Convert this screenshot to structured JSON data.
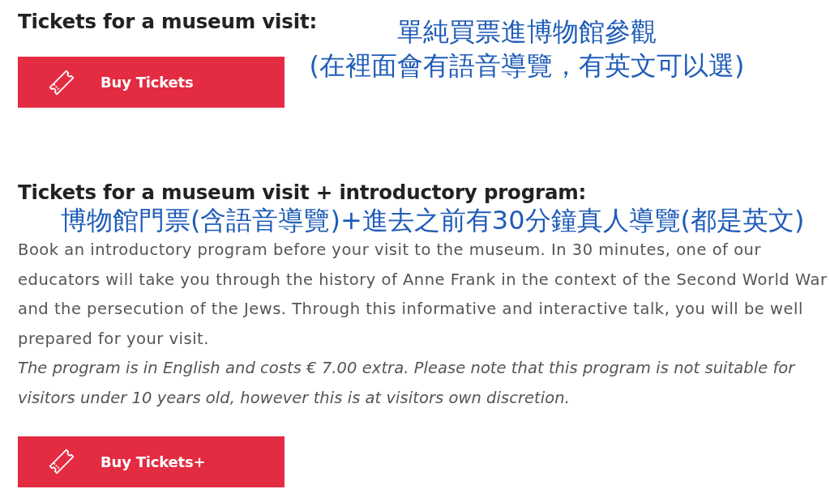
{
  "sections": [
    {
      "kind": "side-note",
      "heading": "Tickets for a museum visit:",
      "annotation": [
        "單純買票進博物館參觀",
        "(在裡面會有語音導覽，有英文可以選)"
      ],
      "button": "Buy Tickets"
    },
    {
      "kind": "inline-note",
      "heading": "Tickets for a museum visit + introductory program:",
      "annotation": [
        "博物館門票(含語音導覽)+進去之前有30分鐘真人導覽(都是英文)"
      ],
      "description": "Book an introductory program before your visit to the museum. In 30 minutes, one of our educators will take you through the history of Anne Frank in the context of the Second World War and the persecution of the Jews. Through this informative and interactive talk, you will be well prepared for your visit.",
      "note": "The program is in English and costs € 7.00 extra. Please note that this program is not suitable for visitors under 10 years old, however this is at visitors own discretion.",
      "button": "Buy Tickets+"
    }
  ]
}
